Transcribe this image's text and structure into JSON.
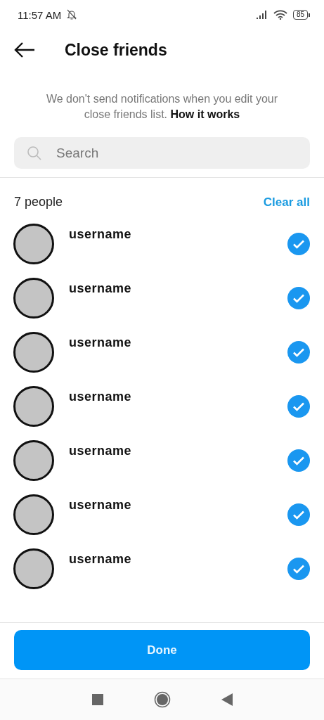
{
  "status_bar": {
    "time": "11:57 AM",
    "battery": "85"
  },
  "header": {
    "title": "Close friends"
  },
  "notice": {
    "text": "We don't send notifications when you edit your close friends list.",
    "link": "How it works"
  },
  "search": {
    "placeholder": "Search"
  },
  "list_header": {
    "count": "7 people",
    "action": "Clear all"
  },
  "friends": [
    {
      "username": "username",
      "checked": true
    },
    {
      "username": "username",
      "checked": true
    },
    {
      "username": "username",
      "checked": true
    },
    {
      "username": "username",
      "checked": true
    },
    {
      "username": "username",
      "checked": true
    },
    {
      "username": "username",
      "checked": true
    },
    {
      "username": "username",
      "checked": true
    }
  ],
  "done_button": "Done"
}
